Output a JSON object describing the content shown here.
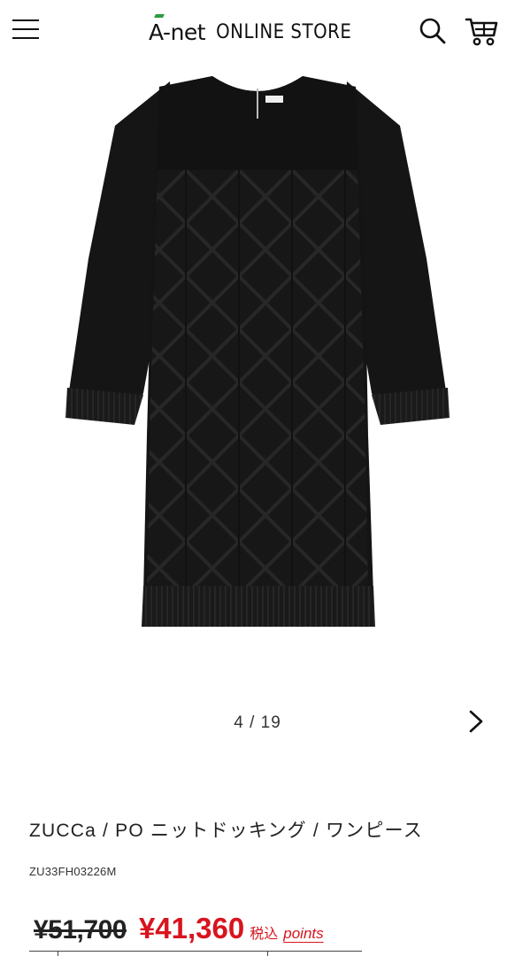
{
  "header": {
    "logo_brand": "A-net",
    "logo_store": "ONLINE STORE",
    "menu_icon": "hamburger-menu-icon",
    "search_icon": "search-icon",
    "cart_icon": "cart-icon",
    "accent_color": "#2e9c3f"
  },
  "gallery": {
    "image_alt": "",
    "current": "4",
    "total": "19",
    "counter_text": "4 / 19",
    "next_icon": "chevron-right-icon"
  },
  "product": {
    "title": "ZUCCa / PO ニットドッキング / ワンピース",
    "code": "ZU33FH03226M",
    "price_old": "¥51,700",
    "price_new": "¥41,360",
    "tax_label": "税込",
    "points_label": "points",
    "sale_color": "#d8141e"
  }
}
